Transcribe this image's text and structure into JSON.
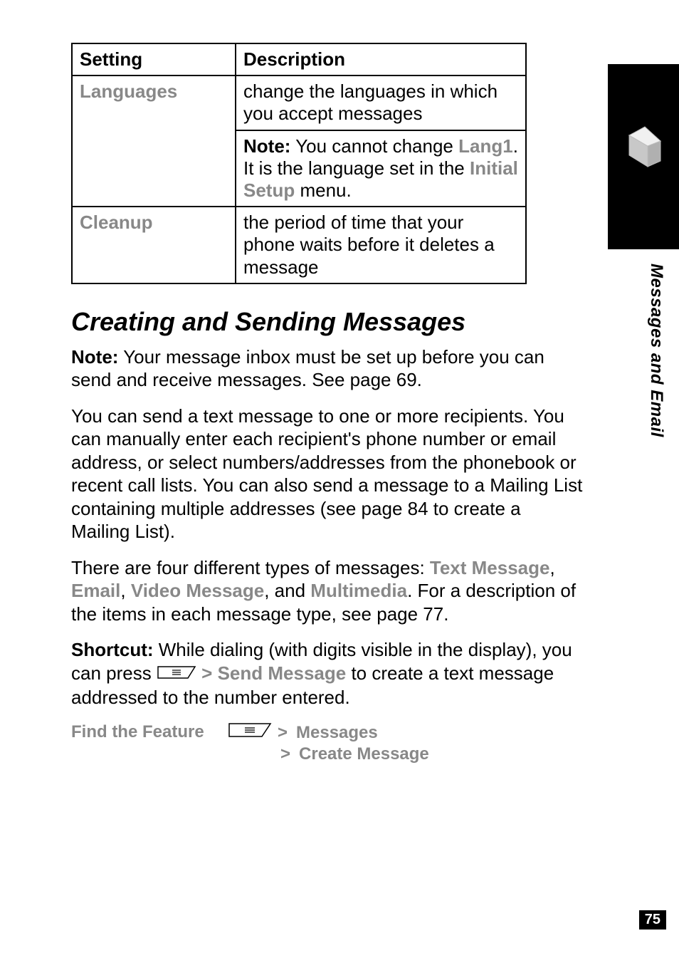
{
  "sideLabel": "Messages and Email",
  "pageNumber": "75",
  "table": {
    "header": {
      "col1": "Setting",
      "col2": "Description"
    },
    "rows": {
      "languages": {
        "name": "Languages",
        "desc1": "change the languages in which you accept messages",
        "note_label": "Note:",
        "note_part1": " You cannot change ",
        "lang1": "Lang1",
        "note_part2": ". It is the language set in the ",
        "initial_setup": "Initial Setup",
        "note_part3": " menu."
      },
      "cleanup": {
        "name": "Cleanup",
        "desc": "the period of time that your phone waits before it deletes a message"
      }
    }
  },
  "sectionTitle": "Creating and Sending Messages",
  "p1": {
    "note_label": "Note:",
    "text": " Your message inbox must be set up before you can send and receive messages. See page 69."
  },
  "p2": "You can send a text message to one or more recipients. You can manually enter each recipient's phone number or email address, or select numbers/addresses from the phonebook or recent call lists. You can also send a message to a Mailing List containing multiple addresses (see page 84 to create a Mailing List).",
  "p3": {
    "pre": "There are four different types of messages: ",
    "t1": "Text Message",
    "c1": ", ",
    "t2": "Email",
    "c2": ", ",
    "t3": "Video Message",
    "c3": ", and ",
    "t4": "Multimedia",
    "post": ". For a description of the items in each message type, see page 77."
  },
  "p4": {
    "label": "Shortcut:",
    "part1": " While dialing (with digits visible in the display), you can press ",
    "caret": " > ",
    "send_message": "Send Message",
    "part2": " to create a text message addressed to the number entered."
  },
  "feature": {
    "label": "Find the Feature",
    "caret": ">",
    "messages": "Messages",
    "create": "Create Message"
  },
  "icons": {
    "menuKey": "menu-key-icon",
    "envelope": "envelope-icon"
  }
}
